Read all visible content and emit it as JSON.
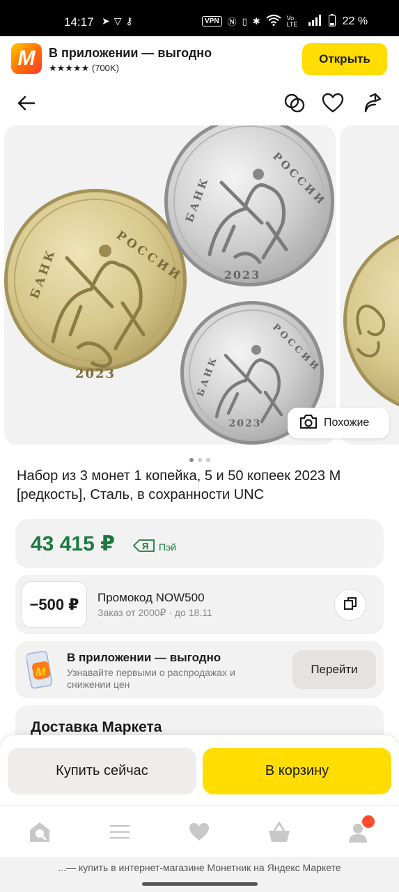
{
  "status_bar": {
    "time": "14:17",
    "left_icons": [
      "telegram-icon",
      "vpn-shield-icon",
      "key-icon"
    ],
    "vpn_label": "VPN",
    "volte_label": "Vo LTE",
    "battery": "22 %"
  },
  "app_banner": {
    "logo_letter": "M",
    "title": "В приложении — выгодно",
    "rating": "★★★★★ (700K)",
    "open_label": "Открыть"
  },
  "gallery": {
    "similar_label": "Похожие",
    "slides_total": 3,
    "active_slide": 0,
    "coin_lettering": [
      "БАНК",
      "РОССИИ",
      "2023"
    ]
  },
  "product": {
    "title": "Набор из 3 монет 1 копейка, 5 и 50 копеек 2023 М [редкость], Сталь, в сохранности UNC"
  },
  "price": {
    "value": "43 415 ₽",
    "pay_label": "Пэй",
    "pay_logo": "Я"
  },
  "promo": {
    "discount": "−500 ₽",
    "title": "Промокод NOW500",
    "subtitle": "Заказ от 2000₽ · до 18.11"
  },
  "app_card": {
    "title": "В приложении — выгодно",
    "subtitle": "Узнавайте первыми о распродажах и снижении цен",
    "go_label": "Перейти"
  },
  "delivery": {
    "title": "Доставка Маркета"
  },
  "actions": {
    "buy_now": "Купить сейчас",
    "add_to_cart": "В корзину"
  },
  "bottom_nav": [
    "home-icon",
    "catalog-icon",
    "favorites-icon",
    "cart-icon",
    "profile-icon"
  ],
  "footer": {
    "caption": "...— купить в интернет-магазине Монетник на Яндекс Маркете"
  },
  "colors": {
    "accent_yellow": "#ffdd00",
    "price_green": "#1b7a3e",
    "notification_red": "#ff4d2e"
  }
}
